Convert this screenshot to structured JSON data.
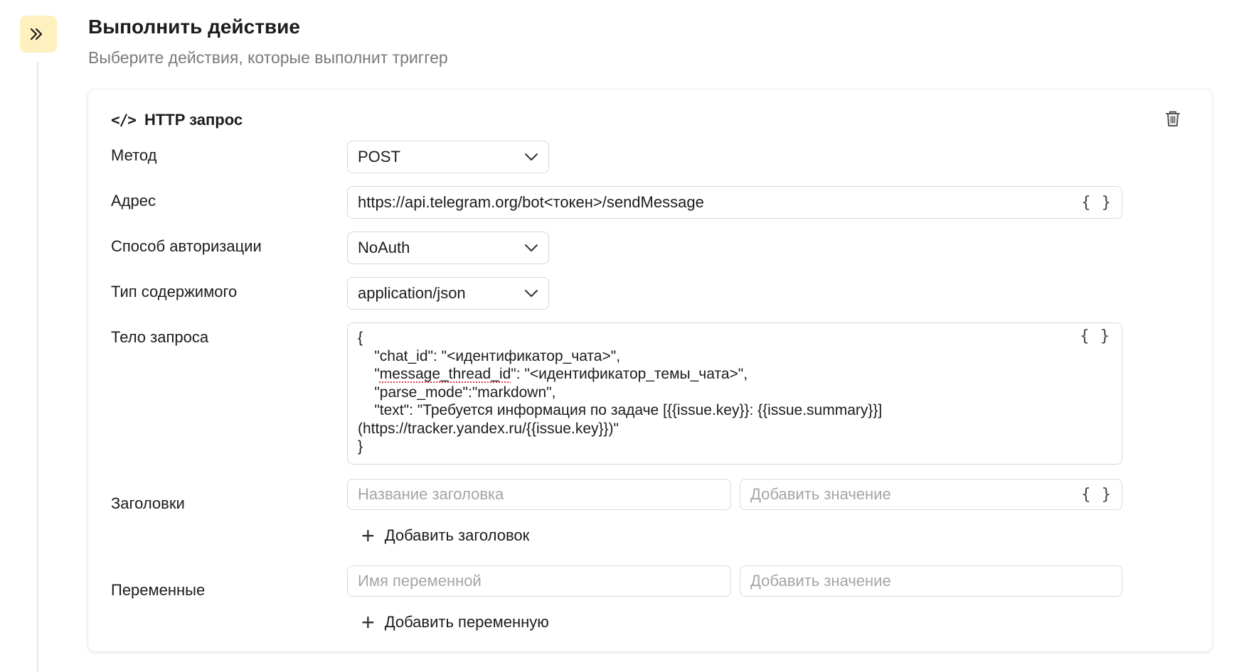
{
  "header": {
    "title": "Выполнить действие",
    "subtitle": "Выберите действия, которые выполнит триггер",
    "step_icon": "double-chevron-right-icon",
    "step_icon_bg": "#fff0c0"
  },
  "card": {
    "icon": "code-icon",
    "icon_glyph": "</>",
    "title": "HTTP запрос",
    "delete_icon": "trash-icon"
  },
  "form": {
    "method": {
      "label": "Метод",
      "value": "POST"
    },
    "address": {
      "label": "Адрес",
      "value": "https://api.telegram.org/bot<токен>/sendMessage",
      "braces": "{ }"
    },
    "auth": {
      "label": "Способ авторизации",
      "value": "NoAuth"
    },
    "content_type": {
      "label": "Тип содержимого",
      "value": "application/json"
    },
    "body": {
      "label": "Тело запроса",
      "braces": "{ }",
      "lines": [
        "{",
        "    \"chat_id\": \"<идентификатор_чата>\",",
        "    \"message_thread_id\": \"<идентификатор_темы_чата>\",",
        "    \"parse_mode\":\"markdown\",",
        "    \"text\": \"Требуется информация по задаче [{{issue.key}}: {{issue.summary}}]",
        "(https://tracker.yandex.ru/{{issue.key}})\"",
        "}"
      ]
    },
    "headers": {
      "label": "Заголовки",
      "name_placeholder": "Название заголовка",
      "value_placeholder": "Добавить значение",
      "braces": "{ }",
      "add_label": "Добавить заголовок"
    },
    "variables": {
      "label": "Переменные",
      "name_placeholder": "Имя переменной",
      "value_placeholder": "Добавить значение",
      "add_label": "Добавить переменную"
    }
  }
}
